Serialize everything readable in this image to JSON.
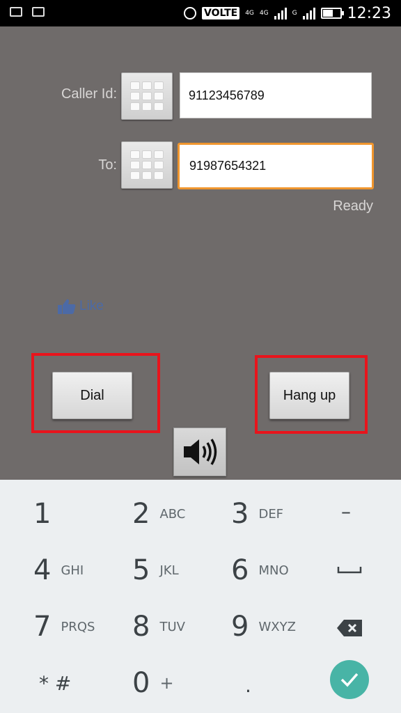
{
  "status_bar": {
    "volte": "VOLTE",
    "network_1": "4G",
    "network_2": "4G",
    "network_3": "G",
    "time": "12:23"
  },
  "form": {
    "caller_id_label": "Caller Id:",
    "caller_id_value": "91123456789",
    "to_label": "To:",
    "to_value": "91987654321",
    "status": "Ready"
  },
  "like_label": "Like",
  "buttons": {
    "dial": "Dial",
    "hang_up": "Hang up"
  },
  "keyboard": {
    "keys": [
      {
        "num": "1",
        "letters": ""
      },
      {
        "num": "2",
        "letters": "ABC"
      },
      {
        "num": "3",
        "letters": "DEF"
      },
      {
        "num": "4",
        "letters": "GHI"
      },
      {
        "num": "5",
        "letters": "JKL"
      },
      {
        "num": "6",
        "letters": "MNO"
      },
      {
        "num": "7",
        "letters": "PRQS"
      },
      {
        "num": "8",
        "letters": "TUV"
      },
      {
        "num": "9",
        "letters": "WXYZ"
      },
      {
        "num": "0",
        "letters": "+"
      }
    ],
    "star_hash": "* #",
    "dash": "–",
    "period": ".",
    "backspace_icon": "backspace-icon",
    "space_icon": "space-icon",
    "done_icon": "check-icon"
  },
  "colors": {
    "background": "#6f6b6a",
    "focus_border": "#f0962e",
    "highlight_box": "#e8141c",
    "done_button": "#48b4a6",
    "like": "#4c6aa6"
  }
}
